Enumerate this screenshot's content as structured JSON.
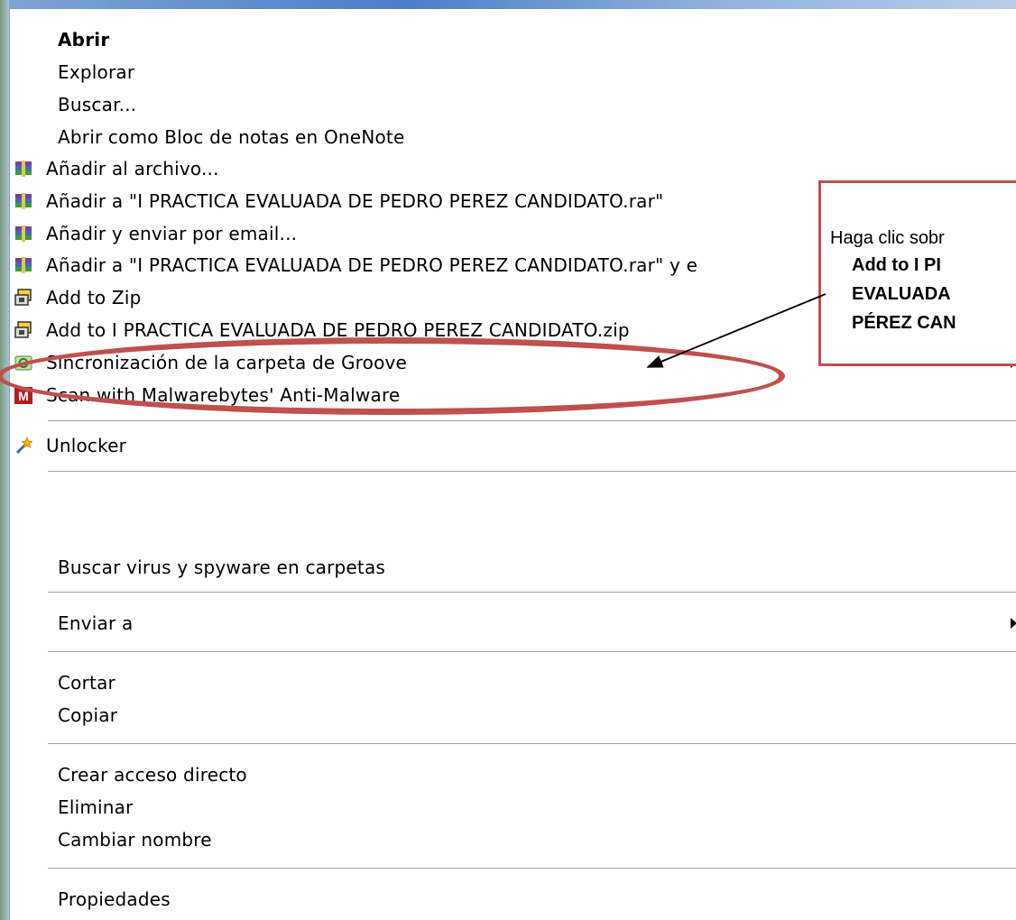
{
  "menu": {
    "items": [
      {
        "id": "abrir",
        "label": "Abrir",
        "bold": true,
        "icon": null
      },
      {
        "id": "explorar",
        "label": "Explorar",
        "icon": null
      },
      {
        "id": "buscar",
        "label": "Buscar...",
        "icon": null
      },
      {
        "id": "onenote",
        "label": "Abrir como Bloc de notas en OneNote",
        "icon": null
      },
      {
        "id": "anadir-archivo",
        "label": "Añadir al archivo...",
        "icon": "winrar-icon"
      },
      {
        "id": "anadir-rar",
        "label": "Añadir a \"I PRACTICA EVALUADA DE PEDRO PEREZ CANDIDATO.rar\"",
        "icon": "winrar-icon"
      },
      {
        "id": "anadir-email",
        "label": "Añadir y enviar por email...",
        "icon": "winrar-icon"
      },
      {
        "id": "anadir-rar-email",
        "label": "Añadir a \"I PRACTICA EVALUADA DE PEDRO PEREZ CANDIDATO.rar\" y e",
        "icon": "winrar-icon"
      },
      {
        "id": "add-zip",
        "label": "Add to Zip",
        "icon": "winzip-icon"
      },
      {
        "id": "add-named-zip",
        "label": "Add to I PRACTICA EVALUADA DE PEDRO PEREZ CANDIDATO.zip",
        "icon": "winzip-icon"
      },
      {
        "id": "groove",
        "label": "Sincronización de la carpeta de Groove",
        "icon": "groove-icon",
        "submenu": true
      },
      {
        "id": "malwarebytes",
        "label": "Scan with Malwarebytes' Anti-Malware",
        "icon": "malwarebytes-icon"
      },
      {
        "id": "unlocker",
        "label": "Unlocker",
        "icon": "unlocker-wand-icon"
      },
      {
        "id": "buscar-virus",
        "label": "Buscar virus y spyware en carpetas",
        "icon": null
      },
      {
        "id": "enviar-a",
        "label": "Enviar a",
        "icon": null,
        "submenu": true
      },
      {
        "id": "cortar",
        "label": "Cortar",
        "icon": null
      },
      {
        "id": "copiar",
        "label": "Copiar",
        "icon": null
      },
      {
        "id": "crear-acceso",
        "label": "Crear acceso directo",
        "icon": null
      },
      {
        "id": "eliminar",
        "label": "Eliminar",
        "icon": null
      },
      {
        "id": "cambiar-nombre",
        "label": "Cambiar nombre",
        "icon": null
      },
      {
        "id": "propiedades",
        "label": "Propiedades",
        "icon": null
      }
    ]
  },
  "callout": {
    "line1": "Haga clic sobr",
    "line2": "Add to  I PI",
    "line3": "EVALUADA",
    "line4": "PÉREZ CAN"
  },
  "colors": {
    "annotation": "#c0504d",
    "separator": "#a0a0a0"
  }
}
